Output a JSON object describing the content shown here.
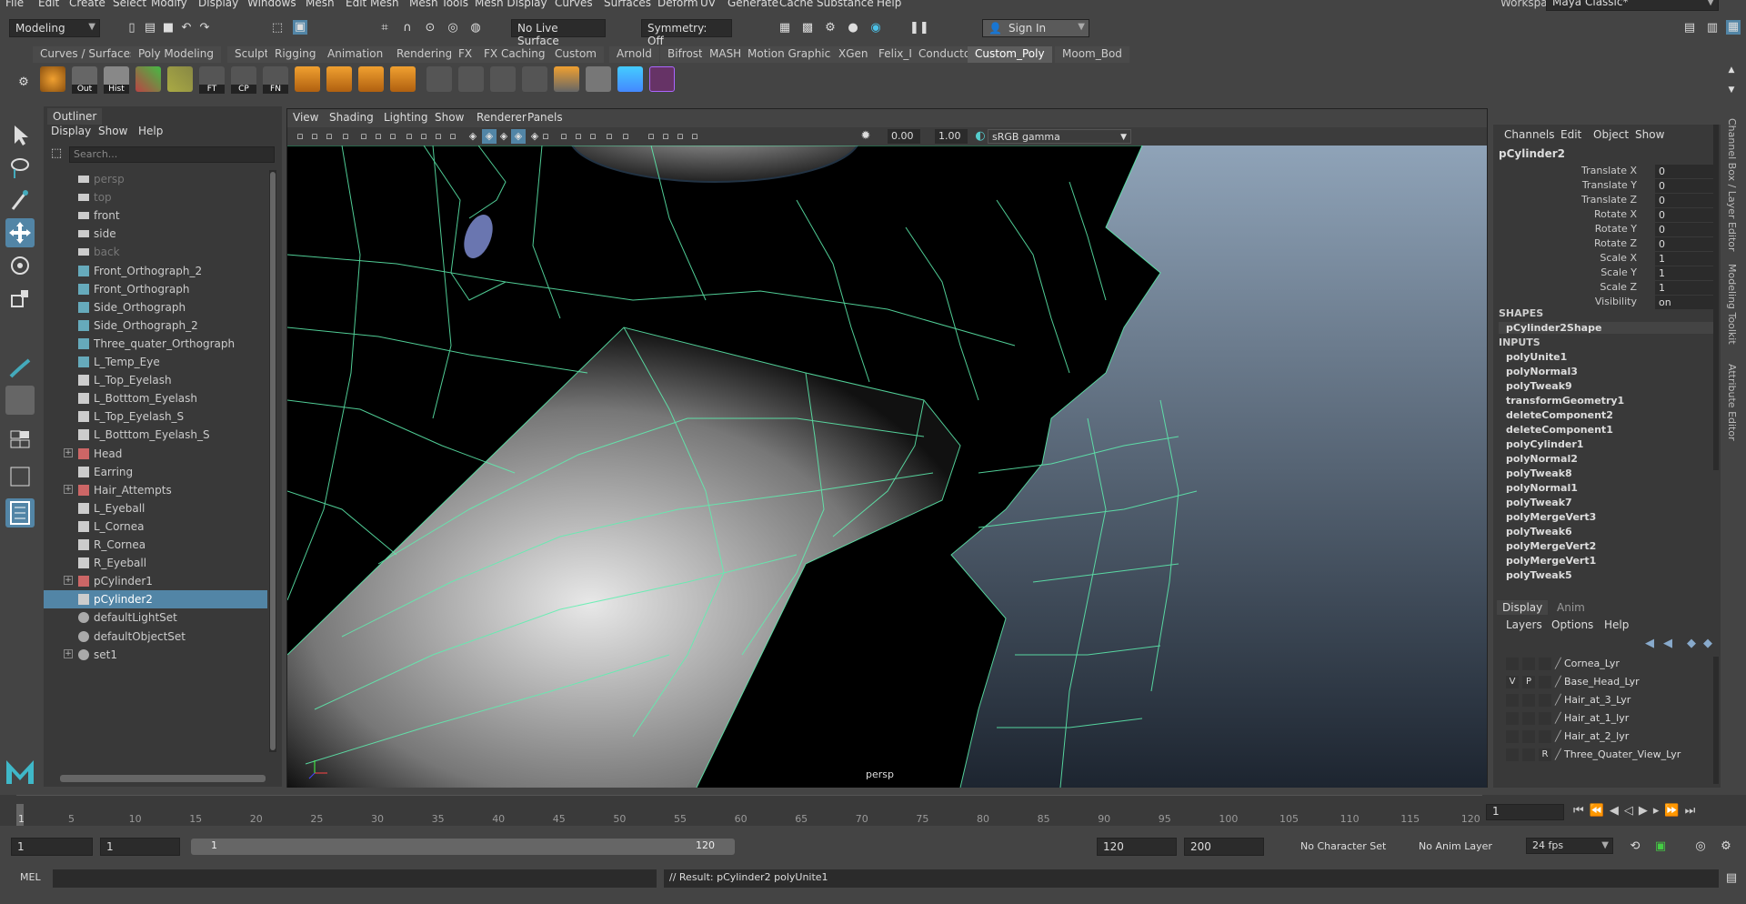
{
  "menubar": {
    "items": [
      "File",
      "Edit",
      "Create",
      "Select",
      "Modify",
      "Display",
      "Windows",
      "Mesh",
      "Edit Mesh",
      "Mesh Tools",
      "Mesh Display",
      "Curves",
      "Surfaces",
      "Deform",
      "UV",
      "Generate",
      "Cache",
      "Substance",
      "Help"
    ],
    "workspace_label": "Workspace :",
    "workspace_value": "Maya Classic*"
  },
  "status": {
    "mode": "Modeling",
    "live_surface": "No Live Surface",
    "symmetry": "Symmetry: Off",
    "sign_in": "Sign In"
  },
  "shelf_tabs": [
    "Curves / Surfaces",
    "Poly Modeling",
    "Sculpting",
    "Rigging",
    "Animation",
    "Rendering",
    "FX",
    "FX Caching",
    "Custom",
    "Arnold",
    "Bifrost",
    "MASH",
    "Motion Graphics",
    "XGen",
    "Felix_Ir",
    "Conductor",
    "Custom_Poly",
    "Moom_Bod"
  ],
  "shelf_active": "Custom_Poly",
  "shelf_icons": [
    {
      "label": ""
    },
    {
      "label": "Out"
    },
    {
      "label": "Hist"
    },
    {
      "label": ""
    },
    {
      "label": ""
    },
    {
      "label": "FT"
    },
    {
      "label": "CP"
    },
    {
      "label": "FN"
    }
  ],
  "outliner": {
    "tab": "Outliner",
    "menu": [
      "Display",
      "Show",
      "Help"
    ],
    "search_placeholder": "Search...",
    "items": [
      {
        "name": "persp",
        "type": "camera",
        "dim": true,
        "exp": false
      },
      {
        "name": "top",
        "type": "camera",
        "dim": true,
        "exp": false
      },
      {
        "name": "front",
        "type": "camera",
        "dim": false,
        "exp": false
      },
      {
        "name": "side",
        "type": "camera",
        "dim": false,
        "exp": false
      },
      {
        "name": "back",
        "type": "camera",
        "dim": true,
        "exp": false
      },
      {
        "name": "Front_Orthograph_2",
        "type": "plane",
        "dim": false,
        "exp": false
      },
      {
        "name": "Front_Orthograph",
        "type": "plane",
        "dim": false,
        "exp": false
      },
      {
        "name": "Side_Orthograph",
        "type": "plane",
        "dim": false,
        "exp": false
      },
      {
        "name": "Side_Orthograph_2",
        "type": "plane",
        "dim": false,
        "exp": false
      },
      {
        "name": "Three_quater_Orthograph",
        "type": "plane",
        "dim": false,
        "exp": false
      },
      {
        "name": "L_Temp_Eye",
        "type": "curve",
        "dim": false,
        "exp": false
      },
      {
        "name": "L_Top_Eyelash",
        "type": "mesh",
        "dim": false,
        "exp": false
      },
      {
        "name": "L_Botttom_Eyelash",
        "type": "mesh",
        "dim": false,
        "exp": false
      },
      {
        "name": "L_Top_Eyelash_S",
        "type": "mesh",
        "dim": false,
        "exp": false
      },
      {
        "name": "L_Botttom_Eyelash_S",
        "type": "mesh",
        "dim": false,
        "exp": false
      },
      {
        "name": "Head",
        "type": "group",
        "dim": false,
        "exp": true
      },
      {
        "name": "Earring",
        "type": "mesh",
        "dim": false,
        "exp": false
      },
      {
        "name": "Hair_Attempts",
        "type": "group",
        "dim": false,
        "exp": true
      },
      {
        "name": "L_Eyeball",
        "type": "mesh",
        "dim": false,
        "exp": false
      },
      {
        "name": "L_Cornea",
        "type": "mesh",
        "dim": false,
        "exp": false
      },
      {
        "name": "R_Cornea",
        "type": "mesh",
        "dim": false,
        "exp": false
      },
      {
        "name": "R_Eyeball",
        "type": "mesh",
        "dim": false,
        "exp": false
      },
      {
        "name": "pCylinder1",
        "type": "group",
        "dim": false,
        "exp": true
      },
      {
        "name": "pCylinder2",
        "type": "mesh",
        "dim": false,
        "exp": false,
        "selected": true
      },
      {
        "name": "defaultLightSet",
        "type": "set",
        "dim": false,
        "exp": false
      },
      {
        "name": "defaultObjectSet",
        "type": "set",
        "dim": false,
        "exp": false
      },
      {
        "name": "set1",
        "type": "set",
        "dim": false,
        "exp": true
      }
    ]
  },
  "viewport": {
    "menu": [
      "View",
      "Shading",
      "Lighting",
      "Show",
      "Renderer",
      "Panels"
    ],
    "exposure": "0.00",
    "gamma": "1.00",
    "colorspace": "sRGB gamma",
    "camera": "persp"
  },
  "channelbox": {
    "menu": [
      "Channels",
      "Edit",
      "Object",
      "Show"
    ],
    "object": "pCylinder2",
    "attrs": [
      {
        "n": "Translate X",
        "v": "0"
      },
      {
        "n": "Translate Y",
        "v": "0"
      },
      {
        "n": "Translate Z",
        "v": "0"
      },
      {
        "n": "Rotate X",
        "v": "0"
      },
      {
        "n": "Rotate Y",
        "v": "0"
      },
      {
        "n": "Rotate Z",
        "v": "0"
      },
      {
        "n": "Scale X",
        "v": "1"
      },
      {
        "n": "Scale Y",
        "v": "1"
      },
      {
        "n": "Scale Z",
        "v": "1"
      },
      {
        "n": "Visibility",
        "v": "on"
      }
    ],
    "shapes_label": "SHAPES",
    "shape": "pCylinder2Shape",
    "inputs_label": "INPUTS",
    "inputs": [
      "polyUnite1",
      "polyNormal3",
      "polyTweak9",
      "transformGeometry1",
      "deleteComponent2",
      "deleteComponent1",
      "polyCylinder1",
      "polyNormal2",
      "polyTweak8",
      "polyNormal1",
      "polyTweak7",
      "polyMergeVert3",
      "polyTweak6",
      "polyMergeVert2",
      "polyMergeVert1",
      "polyTweak5"
    ]
  },
  "sidetabs": [
    "Channel Box / Layer Editor",
    "Modeling Toolkit",
    "Attribute Editor"
  ],
  "layereditor": {
    "tabs": [
      "Display",
      "Anim"
    ],
    "menu": [
      "Layers",
      "Options",
      "Help"
    ],
    "layers": [
      {
        "v": "",
        "p": "",
        "r": "",
        "name": "Cornea_Lyr"
      },
      {
        "v": "V",
        "p": "P",
        "r": "",
        "name": "Base_Head_Lyr"
      },
      {
        "v": "",
        "p": "",
        "r": "",
        "name": "Hair_at_3_Lyr"
      },
      {
        "v": "",
        "p": "",
        "r": "",
        "name": "Hair_at_1_lyr"
      },
      {
        "v": "",
        "p": "",
        "r": "",
        "name": "Hair_at_2_lyr"
      },
      {
        "v": "",
        "p": "",
        "r": "R",
        "name": "Three_Quater_View_Lyr"
      }
    ]
  },
  "timeslider": {
    "ticks": [
      "5",
      "10",
      "15",
      "20",
      "25",
      "30",
      "35",
      "40",
      "45",
      "50",
      "55",
      "60",
      "65",
      "70",
      "75",
      "80",
      "85",
      "90",
      "95",
      "100",
      "105",
      "110",
      "115",
      "120"
    ],
    "first": "1",
    "current": "1"
  },
  "range": {
    "start": "1",
    "playstart": "1",
    "slider_start": "1",
    "slider_end": "120",
    "playend": "120",
    "end": "200",
    "charset": "No Character Set",
    "animlayer": "No Anim Layer",
    "fps": "24 fps"
  },
  "cmd": {
    "label": "MEL",
    "result": "// Result: pCylinder2 polyUnite1"
  }
}
